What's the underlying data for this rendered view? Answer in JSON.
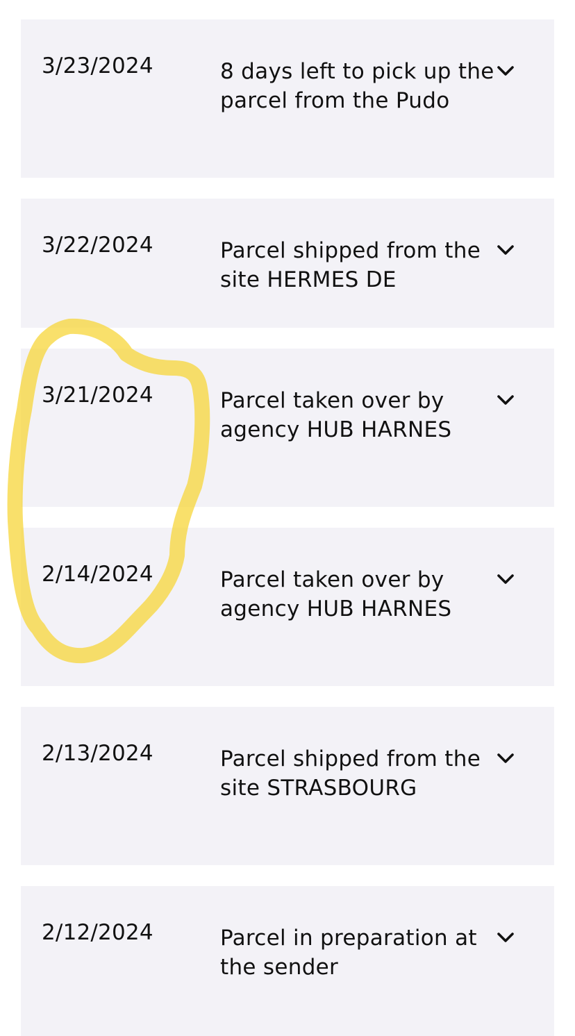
{
  "tracking": {
    "events": [
      {
        "date": "3/23/2024",
        "description": "8 days left to pick up the parcel from the Pudo",
        "icon": "chevron-down-icon"
      },
      {
        "date": "3/22/2024",
        "description": "Parcel shipped from the site HERMES DE",
        "icon": "chevron-down-icon"
      },
      {
        "date": "3/21/2024",
        "description": "Parcel taken over by agency HUB HARNES",
        "icon": "chevron-down-icon"
      },
      {
        "date": "2/14/2024",
        "description": "Parcel taken over by agency HUB HARNES",
        "icon": "chevron-down-icon"
      },
      {
        "date": "2/13/2024",
        "description": "Parcel shipped from the site STRASBOURG",
        "icon": "chevron-down-icon"
      },
      {
        "date": "2/12/2024",
        "description": "Parcel in preparation at the sender",
        "icon": "chevron-down-icon"
      }
    ]
  },
  "colors": {
    "card_background": "#f3f2f7",
    "text": "#111111",
    "highlight_marker": "#f7d53a"
  }
}
